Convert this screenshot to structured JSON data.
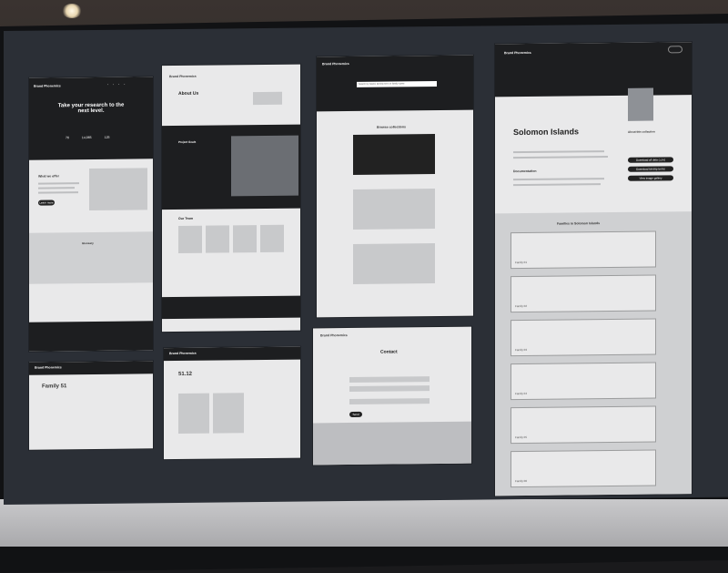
{
  "artboards": {
    "home": {
      "logo": "Brand Phonemics",
      "hero_title": "Take your research to the next level.",
      "stats": [
        "76",
        "14,065",
        "125"
      ],
      "section_title": "What we offer",
      "button_label": "Learn more",
      "about_title": "Glossary"
    },
    "about": {
      "logo": "Brand Phonemics",
      "title": "About Us",
      "project_title": "Project Goals",
      "team_title": "Our Team"
    },
    "browse": {
      "logo": "Brand Phonemics",
      "search_placeholder": "Search by island, kinship term or family name",
      "section_title": "Browse collections"
    },
    "island": {
      "logo": "Brand Phonemics",
      "title": "Solomon Islands",
      "doc_heading": "Documentation",
      "families_title": "Families in Solomon Islands",
      "family_labels": [
        "Family 01",
        "Family 02",
        "Family 03",
        "Family 04",
        "Family 05",
        "Family 06"
      ],
      "buttons": [
        "Download all data (.csv)",
        "Download kinship terms",
        "View image gallery"
      ],
      "sidebar_title": "About this collection"
    },
    "family": {
      "logo": "Brand Phonemics",
      "title": "Family 51"
    },
    "detail": {
      "logo": "Brand Phonemics",
      "title": "51.12"
    },
    "contact": {
      "logo": "Brand Phonemics",
      "title": "Contact",
      "submit_label": "Send"
    }
  }
}
